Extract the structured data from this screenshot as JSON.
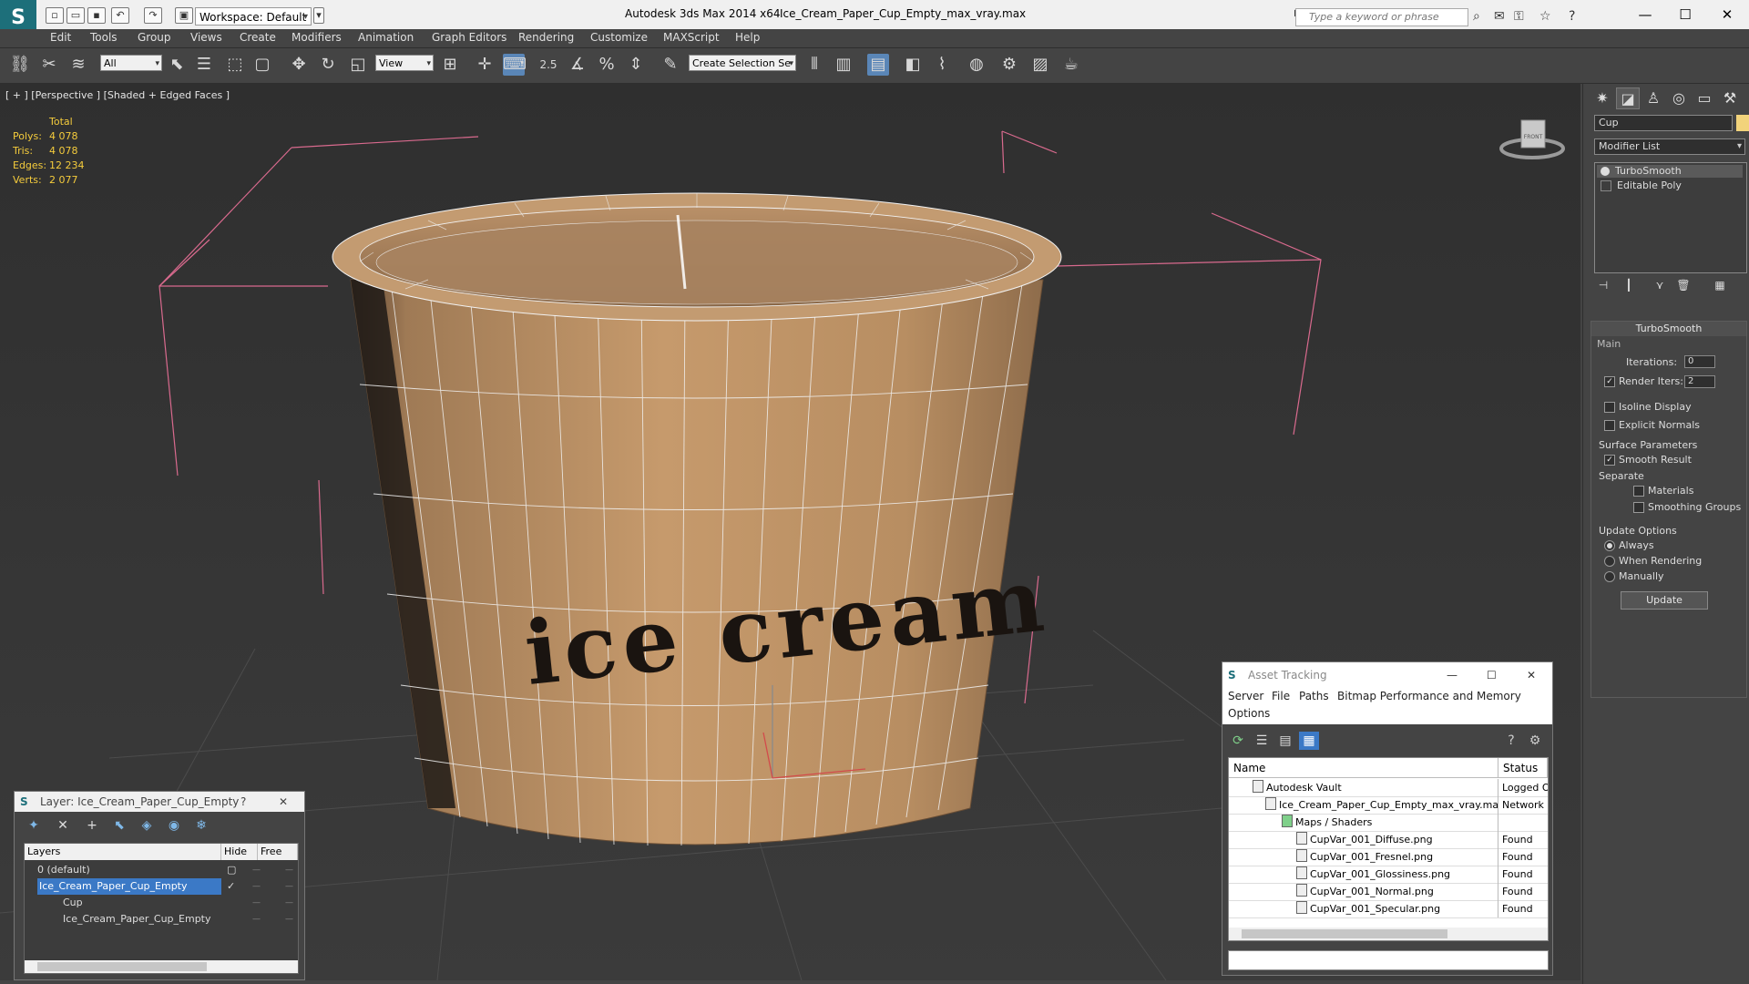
{
  "titlebar": {
    "workspace": "Workspace: Default",
    "app_title": "Autodesk 3ds Max  2014 x64",
    "file_title": "Ice_Cream_Paper_Cup_Empty_max_vray.max",
    "search_placeholder": "Type a keyword or phrase",
    "minimize": "—",
    "maximize": "☐",
    "close": "✕"
  },
  "menubar": {
    "items": [
      "Edit",
      "Tools",
      "Group",
      "Views",
      "Create",
      "Modifiers",
      "Animation",
      "Graph Editors",
      "Rendering",
      "Customize",
      "MAXScript",
      "Help"
    ]
  },
  "toolbar": {
    "filter": "All",
    "ref_coord": "View",
    "selection_set": "Create Selection Se",
    "snap_label": "2.5"
  },
  "viewport": {
    "label": "[ + ] [Perspective ] [Shaded + Edged Faces ]",
    "stats": {
      "header": "Total",
      "rows": [
        {
          "label": "Polys:",
          "value": "4 078"
        },
        {
          "label": "Tris:",
          "value": "4 078"
        },
        {
          "label": "Edges:",
          "value": "12 234"
        },
        {
          "label": "Verts:",
          "value": "2 077"
        }
      ]
    },
    "cup_text": "ice cream",
    "viewcube_label": "FRONT"
  },
  "command_panel": {
    "object_name": "Cup",
    "object_color": "#f2d37b",
    "modifier_list": "Modifier List",
    "stack": [
      "TurboSmooth",
      "Editable Poly"
    ],
    "rollout_title": "TurboSmooth",
    "main_label": "Main",
    "iterations_label": "Iterations:",
    "iterations_value": "0",
    "render_iters_label": "Render Iters:",
    "render_iters_value": "2",
    "render_iters_checked": true,
    "isoline_label": "Isoline Display",
    "explicit_normals_label": "Explicit Normals",
    "surface_params_label": "Surface Parameters",
    "smooth_result_label": "Smooth Result",
    "separate_label": "Separate",
    "materials_label": "Materials",
    "smoothing_groups_label": "Smoothing Groups",
    "update_options_label": "Update Options",
    "always_label": "Always",
    "when_rendering_label": "When Rendering",
    "manually_label": "Manually",
    "update_button": "Update"
  },
  "layer_window": {
    "title": "Layer: Ice_Cream_Paper_Cup_Empty",
    "help": "?",
    "close": "✕",
    "columns": [
      "Layers",
      "Hide",
      "Free"
    ],
    "rows": [
      {
        "name": "0 (default)",
        "indent": 1,
        "selected": false
      },
      {
        "name": "Ice_Cream_Paper_Cup_Empty",
        "indent": 1,
        "selected": true
      },
      {
        "name": "Cup",
        "indent": 3,
        "selected": false
      },
      {
        "name": "Ice_Cream_Paper_Cup_Empty",
        "indent": 3,
        "selected": false
      }
    ]
  },
  "asset_tracking": {
    "title": "Asset Tracking",
    "menu": [
      "Server",
      "File",
      "Paths",
      "Bitmap Performance and Memory",
      "Options"
    ],
    "columns": [
      "Name",
      "Status"
    ],
    "rows": [
      {
        "name": "Autodesk Vault",
        "status": "Logged O",
        "indent": 2
      },
      {
        "name": "Ice_Cream_Paper_Cup_Empty_max_vray.max",
        "status": "Network F",
        "indent": 3
      },
      {
        "name": "Maps / Shaders",
        "status": "",
        "indent": 4
      },
      {
        "name": "CupVar_001_Diffuse.png",
        "status": "Found",
        "indent": 5
      },
      {
        "name": "CupVar_001_Fresnel.png",
        "status": "Found",
        "indent": 5
      },
      {
        "name": "CupVar_001_Glossiness.png",
        "status": "Found",
        "indent": 5
      },
      {
        "name": "CupVar_001_Normal.png",
        "status": "Found",
        "indent": 5
      },
      {
        "name": "CupVar_001_Specular.png",
        "status": "Found",
        "indent": 5
      }
    ]
  }
}
